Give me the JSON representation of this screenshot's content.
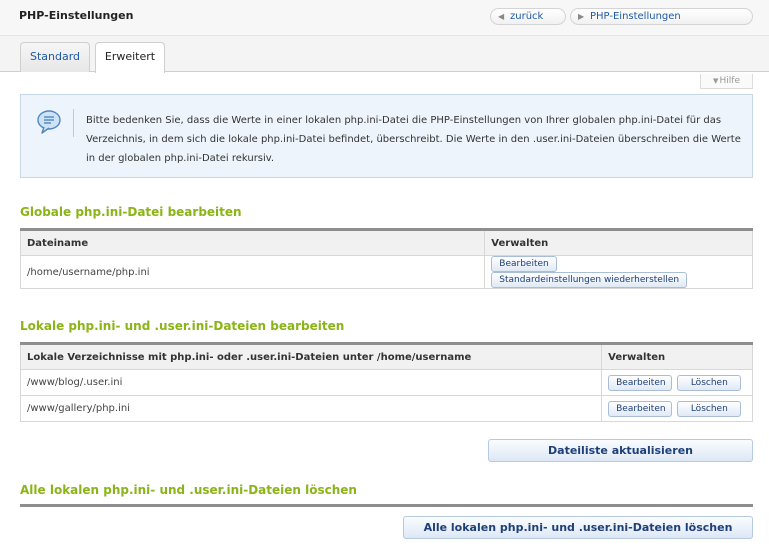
{
  "header": {
    "title": "PHP-Einstellungen",
    "back_label": "zurück",
    "breadcrumb_label": "PHP-Einstellungen"
  },
  "tabs": [
    {
      "label": "Standard",
      "active": false
    },
    {
      "label": "Erweitert",
      "active": true
    }
  ],
  "help_label": "Hilfe",
  "info": {
    "text": "Bitte bedenken Sie, dass die Werte in einer lokalen php.ini-Datei die PHP-Einstellungen von Ihrer globalen php.ini-Datei für das Verzeichnis, in dem sich die lokale php.ini-Datei befindet, überschreibt. Die Werte in den .user.ini-Dateien überschreiben die Werte in der globalen php.ini-Datei rekursiv."
  },
  "global_section": {
    "title": "Globale php.ini-Datei bearbeiten",
    "columns": [
      "Dateiname",
      "Verwalten"
    ],
    "rows": [
      {
        "file": "/home/username/php.ini",
        "actions": [
          "Bearbeiten",
          "Standardeinstellungen wiederherstellen"
        ]
      }
    ]
  },
  "local_section": {
    "title": "Lokale php.ini- und .user.ini-Dateien bearbeiten",
    "columns": [
      "Lokale Verzeichnisse mit php.ini- oder .user.ini-Dateien unter /home/username",
      "Verwalten"
    ],
    "rows": [
      {
        "file": "/www/blog/.user.ini",
        "actions": [
          "Bearbeiten",
          "Löschen"
        ]
      },
      {
        "file": "/www/gallery/php.ini",
        "actions": [
          "Bearbeiten",
          "Löschen"
        ]
      }
    ],
    "refresh_label": "Dateiliste aktualisieren"
  },
  "delete_section": {
    "title": "Alle lokalen php.ini- und .user.ini-Dateien löschen",
    "button_label": "Alle lokalen php.ini- und .user.ini-Dateien löschen"
  },
  "colors": {
    "section_title": "#8ab417",
    "link": "#1f5aa6",
    "info_bg": "#eef4fb"
  }
}
